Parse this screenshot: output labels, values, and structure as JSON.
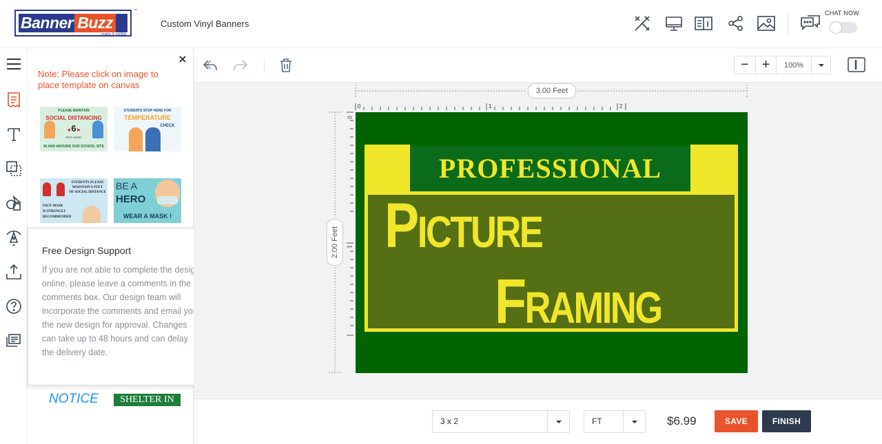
{
  "header": {
    "logo": {
      "word1": "Banner",
      "word2": "Buzz",
      "tagline": "make it visible",
      "tm": "™"
    },
    "product_title": "Custom Vinyl Banners",
    "icons": [
      "tools-icon",
      "desktop-preview-icon",
      "guide-book-icon",
      "share-icon",
      "image-icon",
      "chat-icon"
    ],
    "chat_now_label": "CHAT NOW",
    "chat_toggle_on": false
  },
  "rail": {
    "items": [
      "templates-icon",
      "text-icon",
      "background-icon",
      "shapes-icon",
      "clipart-icon",
      "upload-icon",
      "help-icon",
      "comments-icon"
    ],
    "active": "templates-icon"
  },
  "template_panel": {
    "close": "×",
    "note": "Note: Please click on image to place template on canvas",
    "templates": [
      {
        "line1": "PLEASE MAINTAIN",
        "line2": "SOCIAL DISTANCING",
        "num": "6",
        "line3": "FEET APART",
        "line4": "IN AND AROUND OUR SCHOOL SITE"
      },
      {
        "line1": "STUDENTS STOP HERE FOR",
        "line2": "TEMPERATURE",
        "line3": "CHECK"
      },
      {
        "line1": "STUDENTS PLEASE",
        "line2": "MAINTAIN 6 FEET",
        "line3": "OF SOCIAL DISTANCE",
        "line4": "FACE MASK",
        "line5": "IS STRONGLY",
        "line6": "RECOMMENDED"
      },
      {
        "line1": "BE A",
        "line2": "HERO",
        "line3": "WEAR A MASK !"
      }
    ],
    "bottom_thumb_1": "NOTICE",
    "bottom_thumb_2": "SHELTER IN"
  },
  "support_popup": {
    "title": "Free Design Support",
    "close": "×",
    "body": "If you are not able to complete the design online, please leave a comments in the comments box. Our design team will incorporate the comments and email you the new design for approval. Changes can take up to 48 hours and can delay the delivery date."
  },
  "toolbar": {
    "icons": [
      "undo-icon",
      "redo-icon",
      "delete-icon"
    ],
    "zoom_value": "100%",
    "zoom_minus": "−",
    "zoom_plus": "+"
  },
  "canvas": {
    "width_label": "3.00 Feet",
    "height_label": "2.00 Feet",
    "ruler_top": [
      "0",
      "1",
      "2"
    ],
    "ruler_left": [
      "0",
      "1"
    ],
    "background_color": "#006400",
    "headline": "PROFESSIONAL",
    "line1": "Picture",
    "line2": "Framing",
    "accent_color": "#f0e62a",
    "panel_color": "#556f14"
  },
  "bottom_bar": {
    "size_value": "3 x 2",
    "unit_value": "FT",
    "price": "$6.99",
    "save_label": "SAVE",
    "finish_label": "FINISH"
  },
  "colors": {
    "brand_orange": "#e8532b",
    "brand_navy": "#2a3b8f",
    "finish_dark": "#2e3a4d"
  }
}
